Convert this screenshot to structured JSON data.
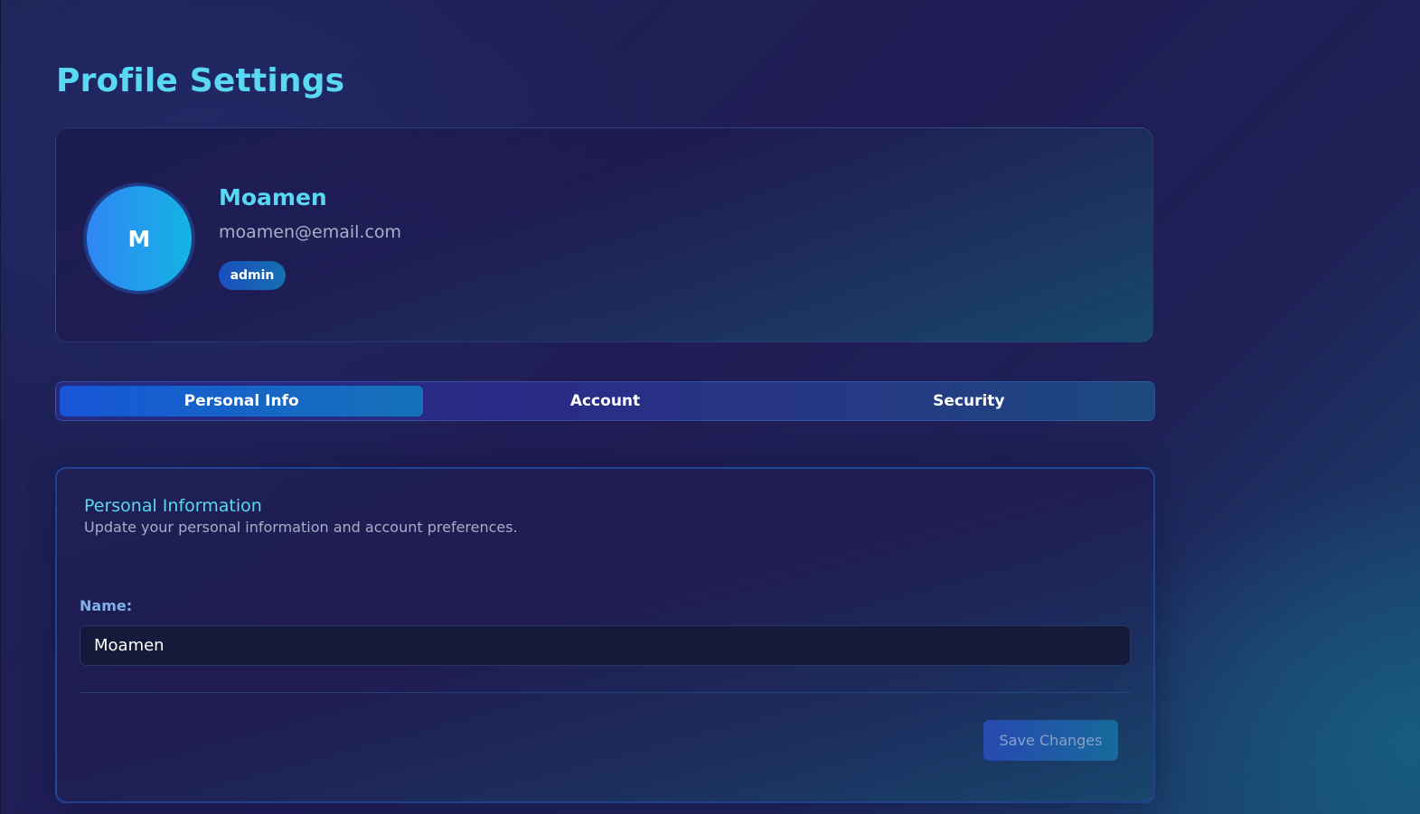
{
  "page": {
    "title": "Profile Settings"
  },
  "profile": {
    "avatar_initial": "M",
    "name": "Moamen",
    "email": "moamen@email.com",
    "role": "admin"
  },
  "tabs": [
    {
      "label": "Personal Info",
      "active": true
    },
    {
      "label": "Account",
      "active": false
    },
    {
      "label": "Security",
      "active": false
    }
  ],
  "personal_info": {
    "title": "Personal Information",
    "subtitle": "Update your personal information and account preferences.",
    "name_label": "Name:",
    "name_value": "Moamen",
    "save_label": "Save Changes"
  },
  "colors": {
    "accent": "#5ad7f2",
    "active_tab": "#1756d8",
    "background": "#1e2056"
  }
}
